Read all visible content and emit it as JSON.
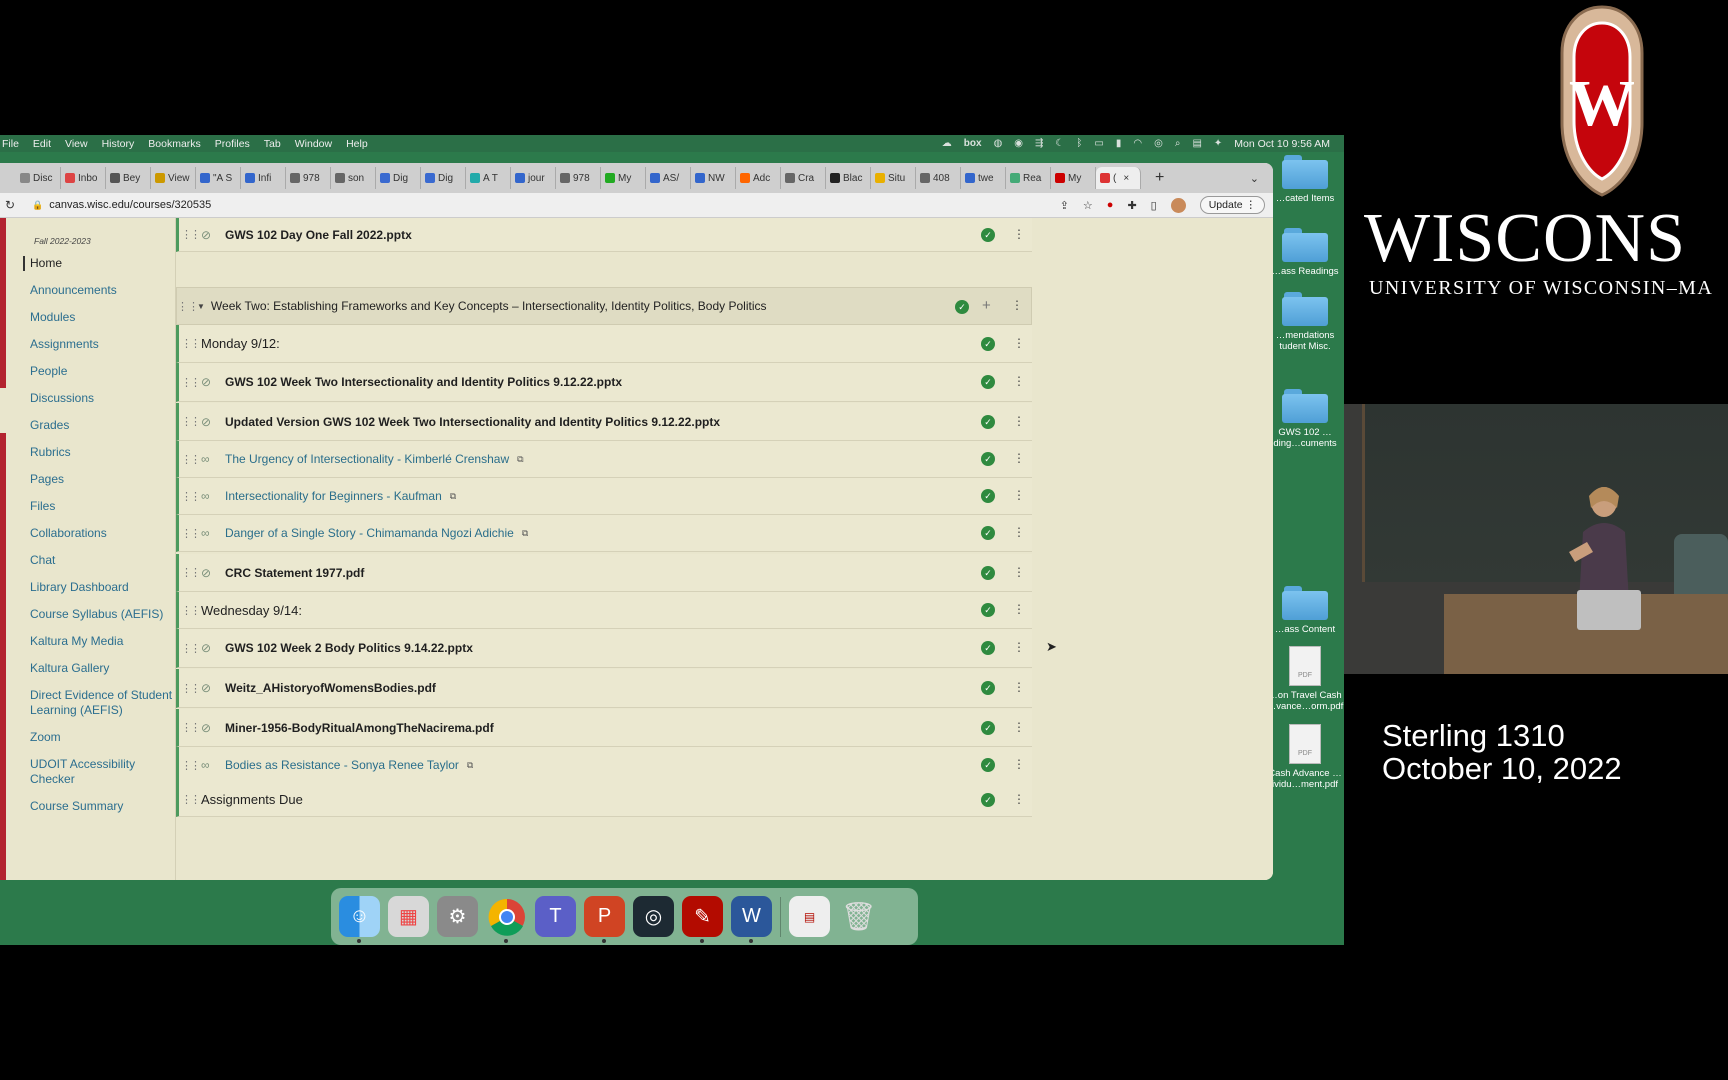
{
  "menubar": {
    "items": [
      "File",
      "Edit",
      "View",
      "History",
      "Bookmarks",
      "Profiles",
      "Tab",
      "Window",
      "Help"
    ],
    "box_label": "box",
    "clock": "Mon Oct 10  9:56 AM"
  },
  "tabs": [
    "Disc",
    "Inbo",
    "Bey",
    "View",
    "\"A S",
    "Infi",
    "978",
    "son",
    "Dig",
    "Dig",
    "A T",
    "jour",
    "978",
    "My",
    "AS/",
    "NW",
    "Adc",
    "Cra",
    "Blac",
    "Situ",
    "408",
    "twe",
    "Rea",
    "My",
    "("
  ],
  "browser": {
    "url": "canvas.wisc.edu/courses/320535",
    "update_label": "Update"
  },
  "course": {
    "term": "Fall 2022-2023",
    "nav": [
      "Home",
      "Announcements",
      "Modules",
      "Assignments",
      "People",
      "Discussions",
      "Grades",
      "Rubrics",
      "Pages",
      "Files",
      "Collaborations",
      "Chat",
      "Library Dashboard",
      "Course Syllabus (AEFIS)",
      "Kaltura My Media",
      "Kaltura Gallery",
      "Direct Evidence of Student Learning (AEFIS)",
      "Zoom",
      "UDOIT Accessibility Checker",
      "Course Summary"
    ]
  },
  "modules": {
    "prev_item": "GWS 102 Day One Fall 2022.pptx",
    "week_title": "Week Two: Establishing Frameworks and Key Concepts – Intersectionality, Identity Politics, Body Politics",
    "items": [
      {
        "title": "Monday 9/12:",
        "kind": "header"
      },
      {
        "title": "GWS 102 Week Two Intersectionality and Identity Politics 9.12.22.pptx",
        "kind": "file"
      },
      {
        "title": "Updated Version GWS 102 Week Two Intersectionality and Identity Politics 9.12.22.pptx",
        "kind": "file"
      },
      {
        "title": "The Urgency of Intersectionality - Kimberlé Crenshaw",
        "kind": "link"
      },
      {
        "title": "Intersectionality for Beginners - Kaufman",
        "kind": "link"
      },
      {
        "title": "Danger of a Single Story - Chimamanda Ngozi Adichie",
        "kind": "link"
      },
      {
        "title": "CRC Statement 1977.pdf",
        "kind": "file"
      },
      {
        "title": "Wednesday 9/14:",
        "kind": "header"
      },
      {
        "title": "GWS 102 Week 2 Body Politics 9.14.22.pptx",
        "kind": "file"
      },
      {
        "title": "Weitz_AHistoryofWomensBodies.pdf",
        "kind": "file"
      },
      {
        "title": "Miner-1956-BodyRitualAmongTheNacirema.pdf",
        "kind": "file"
      },
      {
        "title": "Bodies as Resistance - Sonya Renee Taylor",
        "kind": "link"
      },
      {
        "title": "Assignments Due",
        "kind": "header"
      }
    ]
  },
  "desktop_icons": [
    {
      "label": "…cated Items",
      "type": "folder"
    },
    {
      "label": "…ass Readings",
      "type": "folder"
    },
    {
      "label": "…mendations tudent Misc.",
      "type": "folder"
    },
    {
      "label": "GWS 102 …ding…cuments",
      "type": "folder"
    },
    {
      "label": "…ass Content",
      "type": "folder"
    },
    {
      "label": "…on Travel Cash …vance…orm.pdf",
      "type": "pdf"
    },
    {
      "label": "Cash Advance …ividu…ment.pdf",
      "type": "pdf"
    }
  ],
  "branding": {
    "crest_letter": "W",
    "wordmark": "WISCONS",
    "university": "UNIVERSITY OF WISCONSIN–MA",
    "location": "Sterling 1310",
    "date": "October 10, 2022"
  },
  "colors": {
    "canvas_red": "#b3232f",
    "link": "#2a6e8b",
    "published_green": "#2f8a3f",
    "desktop_green": "#2c7a4b"
  }
}
